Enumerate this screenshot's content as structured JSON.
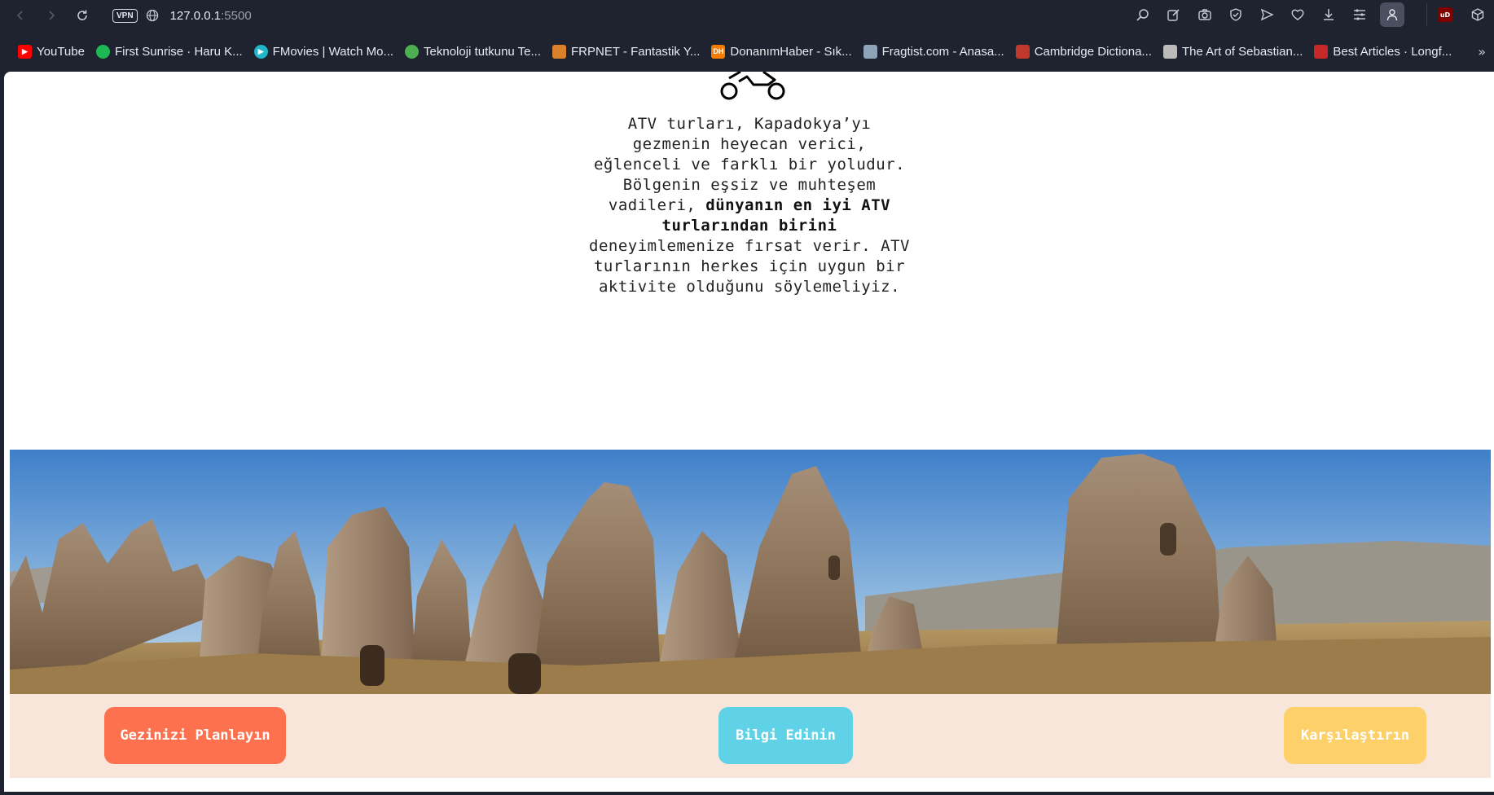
{
  "browser": {
    "vpn_label": "VPN",
    "url_host": "127.0.0.1",
    "url_port": ":5500",
    "ublock_label": "uD"
  },
  "bookmarks": [
    {
      "label": "YouTube",
      "icon": "youtube-icon",
      "color": "#ff0000"
    },
    {
      "label": "First Sunrise · Haru K...",
      "icon": "spotify-icon",
      "color": "#1db954"
    },
    {
      "label": "FMovies | Watch Mo...",
      "icon": "play-icon",
      "color": "#1fb6c9"
    },
    {
      "label": "Teknoloji tutkunu Te...",
      "icon": "power-icon",
      "color": "#4caf50"
    },
    {
      "label": "FRPNET - Fantastik Y...",
      "icon": "frpnet-icon",
      "color": "#d9822b"
    },
    {
      "label": "DonanımHaber - Sık...",
      "icon": "dh-icon",
      "color": "#f57c00",
      "icon_text": "DH"
    },
    {
      "label": "Fragtist.com - Anasa...",
      "icon": "fragtist-icon",
      "color": "#8fa3b8"
    },
    {
      "label": "Cambridge Dictiona...",
      "icon": "cambridge-icon",
      "color": "#c0392b"
    },
    {
      "label": "The Art of Sebastian...",
      "icon": "art-icon",
      "color": "#bbbbbb"
    },
    {
      "label": "Best Articles · Longf...",
      "icon": "longform-icon",
      "color": "#c62828"
    }
  ],
  "page": {
    "intro_part1": "ATV turları, Kapadokya’yı gezmenin heyecan verici, eğlenceli ve farklı bir yoludur. Bölgenin eşsiz ve muhteşem vadileri, ",
    "intro_bold": "dünyanın en iyi ATV turlarından birini",
    "intro_part2": " deneyimlemenize fırsat verir. ATV turlarının herkes için uygun bir aktivite olduğunu söylemeliyiz.",
    "buttons": {
      "plan": "Gezinizi Planlayın",
      "info": "Bilgi Edinin",
      "compare": "Karşılaştırın"
    },
    "colors": {
      "plan": "#fd714e",
      "info": "#5fd2e7",
      "compare": "#fdd06a",
      "strip": "#f8e6db"
    }
  }
}
